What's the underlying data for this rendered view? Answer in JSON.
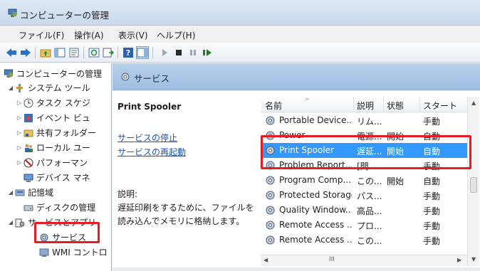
{
  "window": {
    "title": "コンピューターの管理"
  },
  "menu": {
    "file": "ファイル(F)",
    "action": "操作(A)",
    "view": "表示(V)",
    "help": "ヘルプ(H)"
  },
  "toolbar": {
    "back": "arrow-left-icon",
    "forward": "arrow-right-icon"
  },
  "tree": {
    "root": "コンピューターの管理",
    "system_tools": "システム ツール",
    "task_scheduler": "タスク スケジ",
    "event_viewer": "イベント ビュ",
    "shared_folders": "共有フォルダー",
    "local_users": "ローカル ユー",
    "performance": "パフォーマン",
    "device_manager": "デバイス マネ",
    "storage": "記憶域",
    "disk_management": "ディスクの管理",
    "services_apps": "サービスとアプリ",
    "services": "サービス",
    "wmi": "WMI コントロ"
  },
  "header": {
    "title": "サービス"
  },
  "detail": {
    "service_name": "Print Spooler",
    "stop_link": "サービスの停止",
    "restart_link": "サービスの再起動",
    "desc_label": "説明:",
    "desc_text": "遅延印刷をするために、ファイルを読み込んでメモリに格納します。"
  },
  "grid": {
    "columns": [
      "名前",
      "説明",
      "状態",
      "スタート"
    ],
    "rows": [
      [
        "Portable Device...",
        "リム...",
        "",
        "手動"
      ],
      [
        "Power",
        "電源...",
        "開始",
        "自動"
      ],
      [
        "Print Spooler",
        "遅延...",
        "開始",
        "自動"
      ],
      [
        "Problem Report...",
        "[問...",
        "",
        "手動"
      ],
      [
        "Program Comp...",
        "この...",
        "開始",
        "自動"
      ],
      [
        "Protected Storage",
        "パス...",
        "",
        "手動"
      ],
      [
        "Quality Window...",
        "高品...",
        "",
        "手動"
      ],
      [
        "Remote Access ...",
        "プロ...",
        "",
        "手動"
      ],
      [
        "Remote Access ...",
        "この...",
        "",
        "手動"
      ]
    ],
    "selected_index": 2,
    "hscroll_label": "III"
  },
  "colors": {
    "selection": "#3399ff",
    "highlight": "#e51c23",
    "header": "#a8c6e6"
  }
}
